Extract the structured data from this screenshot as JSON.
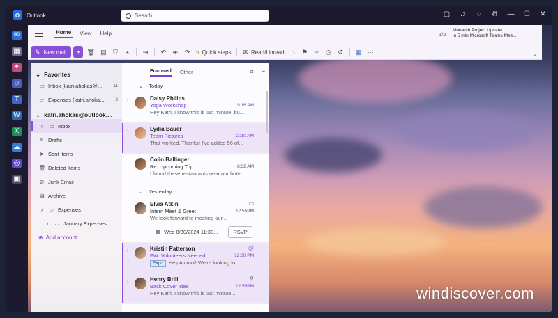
{
  "app": {
    "title": "Outlook",
    "search_placeholder": "Search"
  },
  "ribbon": {
    "tabs": [
      "Home",
      "View",
      "Help"
    ],
    "active_tab": "Home",
    "new_mail": "New mail",
    "quick_steps": "Quick steps",
    "read_unread": "Read/Unread"
  },
  "notification": {
    "page": "1/2",
    "title": "Monarch Project Update",
    "detail": "in 5 min Microsoft Teams Mee..."
  },
  "folders": {
    "favorites_label": "Favorites",
    "favorites": [
      {
        "label": "Inbox (katri.ahokas@...",
        "count": "11"
      },
      {
        "label": "Expenses (katri.ahoka...",
        "count": "2"
      }
    ],
    "account_label": "katri.ahokas@outlook....",
    "items": [
      {
        "label": "Inbox",
        "icon": "inbox-icon"
      },
      {
        "label": "Drafts",
        "icon": "draft-icon"
      },
      {
        "label": "Sent Items",
        "icon": "send-icon"
      },
      {
        "label": "Deleted Items",
        "icon": "trash-icon"
      },
      {
        "label": "Junk Email",
        "icon": "junk-icon"
      },
      {
        "label": "Archive",
        "icon": "archive-icon"
      },
      {
        "label": "Expenses",
        "icon": "folder-icon"
      },
      {
        "label": "January Expenses",
        "icon": "folder-icon"
      }
    ],
    "add_account": "Add account"
  },
  "list": {
    "tabs": [
      "Focused",
      "Other"
    ],
    "groups": [
      "Today",
      "Yesterday"
    ],
    "messages": [
      {
        "from": "Daisy Philips",
        "subject": "Yoga Workshop",
        "preview": "Hey Katri, I know this is last minute, bu...",
        "time": "9:16 AM"
      },
      {
        "from": "Lydia Bauer",
        "subject": "Team Pictures",
        "preview": "That worked. Thanks! I've added 56 of...",
        "time": "11:10 AM"
      },
      {
        "from": "Colin Ballinger",
        "subject": "Re: Upcoming Trip",
        "preview": "I found these restaurants near our hotel...",
        "time": "8:32 AM"
      },
      {
        "from": "Elvia Atkin",
        "subject": "Intern Meet & Greet",
        "preview": "We look forward to meeting our...",
        "time": "12:55PM",
        "invite": "Wed 8/30/2024 11:30...",
        "rsvp": "RSVP"
      },
      {
        "from": "Kristin Patterson",
        "subject": "FW: Volunteers Needed",
        "preview": "Hey Alumni! We're looking fo...",
        "time": "12:30 PM",
        "tag": "Expo"
      },
      {
        "from": "Henry Brill",
        "subject": "Back Cover Idea",
        "preview": "Hey Katri, I know this is last minute...",
        "time": "12:55PM"
      }
    ]
  },
  "watermark": "windiscover.com",
  "colors": {
    "accent": "#8a4fd8",
    "titlebar": "#1b1a2e"
  }
}
